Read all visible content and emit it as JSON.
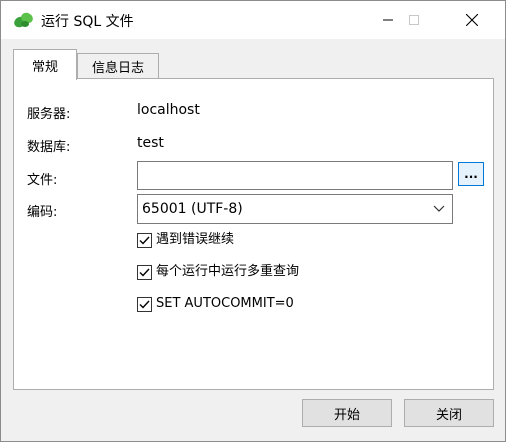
{
  "window": {
    "title": "运行 SQL 文件",
    "icon": "leaf-logo-icon"
  },
  "tabs": [
    {
      "label": "常规",
      "active": true
    },
    {
      "label": "信息日志",
      "active": false
    }
  ],
  "fields": {
    "server_label": "服务器:",
    "server_value": "localhost",
    "database_label": "数据库:",
    "database_value": "test",
    "file_label": "文件:",
    "file_value": "",
    "browse_label": "...",
    "encoding_label": "编码:",
    "encoding_value": "65001 (UTF-8)"
  },
  "options": [
    {
      "label": "遇到错误继续",
      "checked": true
    },
    {
      "label": "每个运行中运行多重查询",
      "checked": true
    },
    {
      "label": "SET AUTOCOMMIT=0",
      "checked": true
    }
  ],
  "buttons": {
    "start": "开始",
    "close": "关闭"
  },
  "colors": {
    "accent": "#0078d7",
    "logo_green": "#3aa13a"
  }
}
